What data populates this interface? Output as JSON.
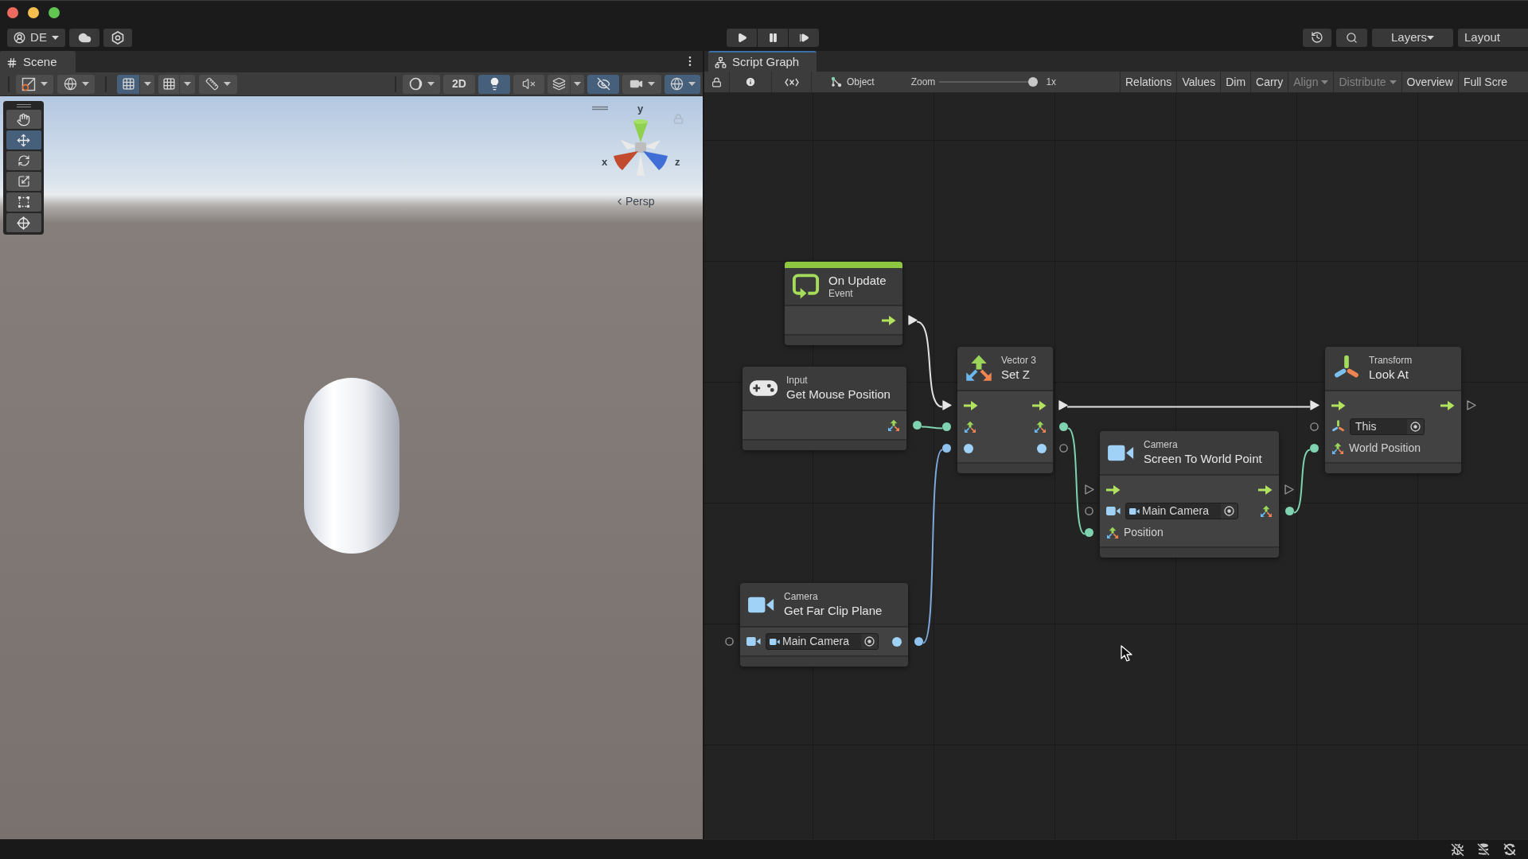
{
  "toolbar": {
    "account": "DE",
    "layers": "Layers",
    "layout": "Layout"
  },
  "scene": {
    "tab": {
      "label": "Scene",
      "selected": true,
      "focused": false
    },
    "toolbar_left": [
      {
        "on": false
      },
      {
        "on": false
      },
      {
        "on": true
      },
      {
        "on": false
      },
      {
        "on": false
      }
    ],
    "toolbar_right": [
      {
        "on": false
      },
      {
        "label": "2D",
        "on": false
      },
      {
        "on": true
      },
      {
        "on": false
      },
      {
        "on": false
      },
      {
        "on": true
      },
      {
        "on": false
      },
      {
        "on": true
      }
    ],
    "tools": [
      {
        "selected": false
      },
      {
        "selected": true
      },
      {
        "selected": false
      },
      {
        "selected": false
      },
      {
        "selected": false
      },
      {
        "selected": false
      }
    ],
    "gizmo_axes": [
      "y",
      "x",
      "z"
    ],
    "projection": "Persp"
  },
  "graph": {
    "tab": {
      "label": "Script Graph",
      "selected": true,
      "focused": true
    },
    "toolbar": {
      "object": "Object",
      "zoom": {
        "label": "Zoom",
        "level": 1,
        "reading": "1x"
      },
      "buttons": [
        {
          "label": "Relations",
          "disabled": false,
          "dropdown": false
        },
        {
          "label": "Values",
          "disabled": false,
          "dropdown": false
        },
        {
          "label": "Dim",
          "disabled": false,
          "dropdown": false
        },
        {
          "label": "Carry",
          "disabled": false,
          "dropdown": false
        },
        {
          "label": "Align",
          "disabled": true,
          "dropdown": true
        },
        {
          "label": "Distribute",
          "disabled": true,
          "dropdown": true
        },
        {
          "label": "Overview",
          "disabled": false,
          "dropdown": false
        },
        {
          "label": "Full Scre",
          "disabled": false,
          "dropdown": false
        }
      ]
    },
    "nodes": [
      {
        "kind": "event",
        "title": "On Update",
        "subtitle": "Event",
        "rows": [
          {
            "output": {
              "kind": "flow",
              "connected": true
            }
          }
        ]
      },
      {
        "kind": "unit",
        "category": "Input",
        "title": "Get Mouse Position",
        "rows": [
          {
            "output": {
              "kind": "vector3",
              "connected": true
            }
          }
        ]
      },
      {
        "kind": "unit",
        "category": "Vector 3",
        "title": "Set Z",
        "rows": [
          {
            "input": {
              "kind": "flow",
              "connected": true
            },
            "output": {
              "kind": "flow",
              "connected": true
            }
          },
          {
            "input": {
              "kind": "vector3",
              "connected": true
            },
            "output": {
              "kind": "vector3",
              "connected": true
            }
          },
          {
            "input": {
              "kind": "float",
              "connected": true
            },
            "output": {
              "kind": "float",
              "connected": false
            }
          }
        ]
      },
      {
        "kind": "unit",
        "category": "Camera",
        "title": "Screen To World Point",
        "rows": [
          {
            "input": {
              "kind": "flow",
              "connected": false
            },
            "output": {
              "kind": "flow",
              "connected": false
            }
          },
          {
            "input": {
              "kind": "camera",
              "connected": false,
              "field": "Main Camera"
            },
            "output": {
              "kind": "vector3",
              "connected": true
            }
          },
          {
            "input": {
              "kind": "vector3",
              "connected": true,
              "label": "Position"
            }
          }
        ]
      },
      {
        "kind": "unit",
        "category": "Camera",
        "title": "Get Far Clip Plane",
        "rows": [
          {
            "input": {
              "kind": "camera",
              "connected": false,
              "field": "Main Camera"
            },
            "output": {
              "kind": "float",
              "connected": true
            }
          }
        ]
      },
      {
        "kind": "unit",
        "category": "Transform",
        "title": "Look At",
        "rows": [
          {
            "input": {
              "kind": "flow",
              "connected": true
            },
            "output": {
              "kind": "flow",
              "connected": false
            }
          },
          {
            "input": {
              "kind": "transform",
              "connected": false,
              "field": "This"
            }
          },
          {
            "input": {
              "kind": "vector3",
              "connected": true,
              "label": "World Position"
            }
          }
        ]
      }
    ]
  }
}
